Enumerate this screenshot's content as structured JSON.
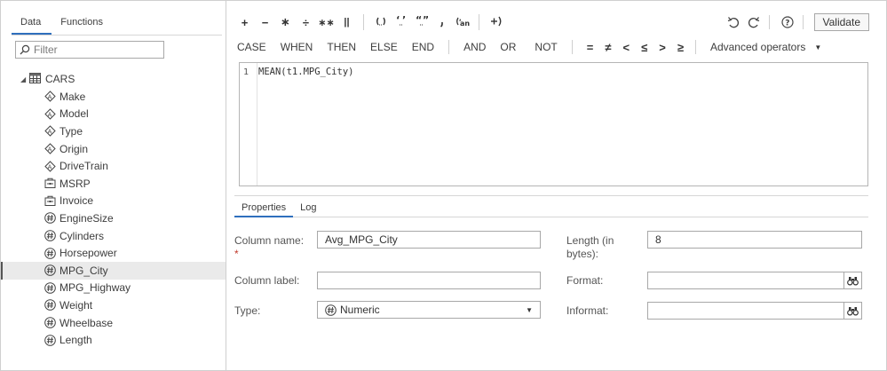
{
  "left_panel": {
    "tabs": [
      "Data",
      "Functions"
    ],
    "filter_placeholder": "Filter",
    "table_name": "CARS",
    "columns": [
      {
        "name": "Make",
        "kind": "character"
      },
      {
        "name": "Model",
        "kind": "character"
      },
      {
        "name": "Type",
        "kind": "character"
      },
      {
        "name": "Origin",
        "kind": "character"
      },
      {
        "name": "DriveTrain",
        "kind": "character"
      },
      {
        "name": "MSRP",
        "kind": "currency"
      },
      {
        "name": "Invoice",
        "kind": "currency"
      },
      {
        "name": "EngineSize",
        "kind": "numeric"
      },
      {
        "name": "Cylinders",
        "kind": "numeric"
      },
      {
        "name": "Horsepower",
        "kind": "numeric"
      },
      {
        "name": "MPG_City",
        "kind": "numeric",
        "selected": true
      },
      {
        "name": "MPG_Highway",
        "kind": "numeric"
      },
      {
        "name": "Weight",
        "kind": "numeric"
      },
      {
        "name": "Wheelbase",
        "kind": "numeric"
      },
      {
        "name": "Length",
        "kind": "numeric"
      }
    ]
  },
  "toolbar": {
    "arith_ops": [
      "+",
      "−",
      "∗",
      "÷",
      "∗∗",
      "||"
    ],
    "validate_label": "Validate",
    "keywords": [
      "CASE",
      "WHEN",
      "THEN",
      "ELSE",
      "END"
    ],
    "logical": [
      "AND",
      "OR",
      "NOT"
    ],
    "comparison": [
      "=",
      "≠",
      "<",
      "≤",
      ">",
      "≥"
    ],
    "advanced_label": "Advanced operators"
  },
  "editor": {
    "line_number": "1",
    "code": "MEAN(t1.MPG_City)"
  },
  "properties": {
    "tabs": [
      "Properties",
      "Log"
    ],
    "column_name_label": "Column name:",
    "column_name_value": "Avg_MPG_City",
    "column_label_label": "Column label:",
    "column_label_value": "",
    "type_label": "Type:",
    "type_value": "Numeric",
    "length_label": "Length (in bytes):",
    "length_value": "8",
    "format_label": "Format:",
    "format_value": "",
    "informat_label": "Informat:",
    "informat_value": ""
  }
}
